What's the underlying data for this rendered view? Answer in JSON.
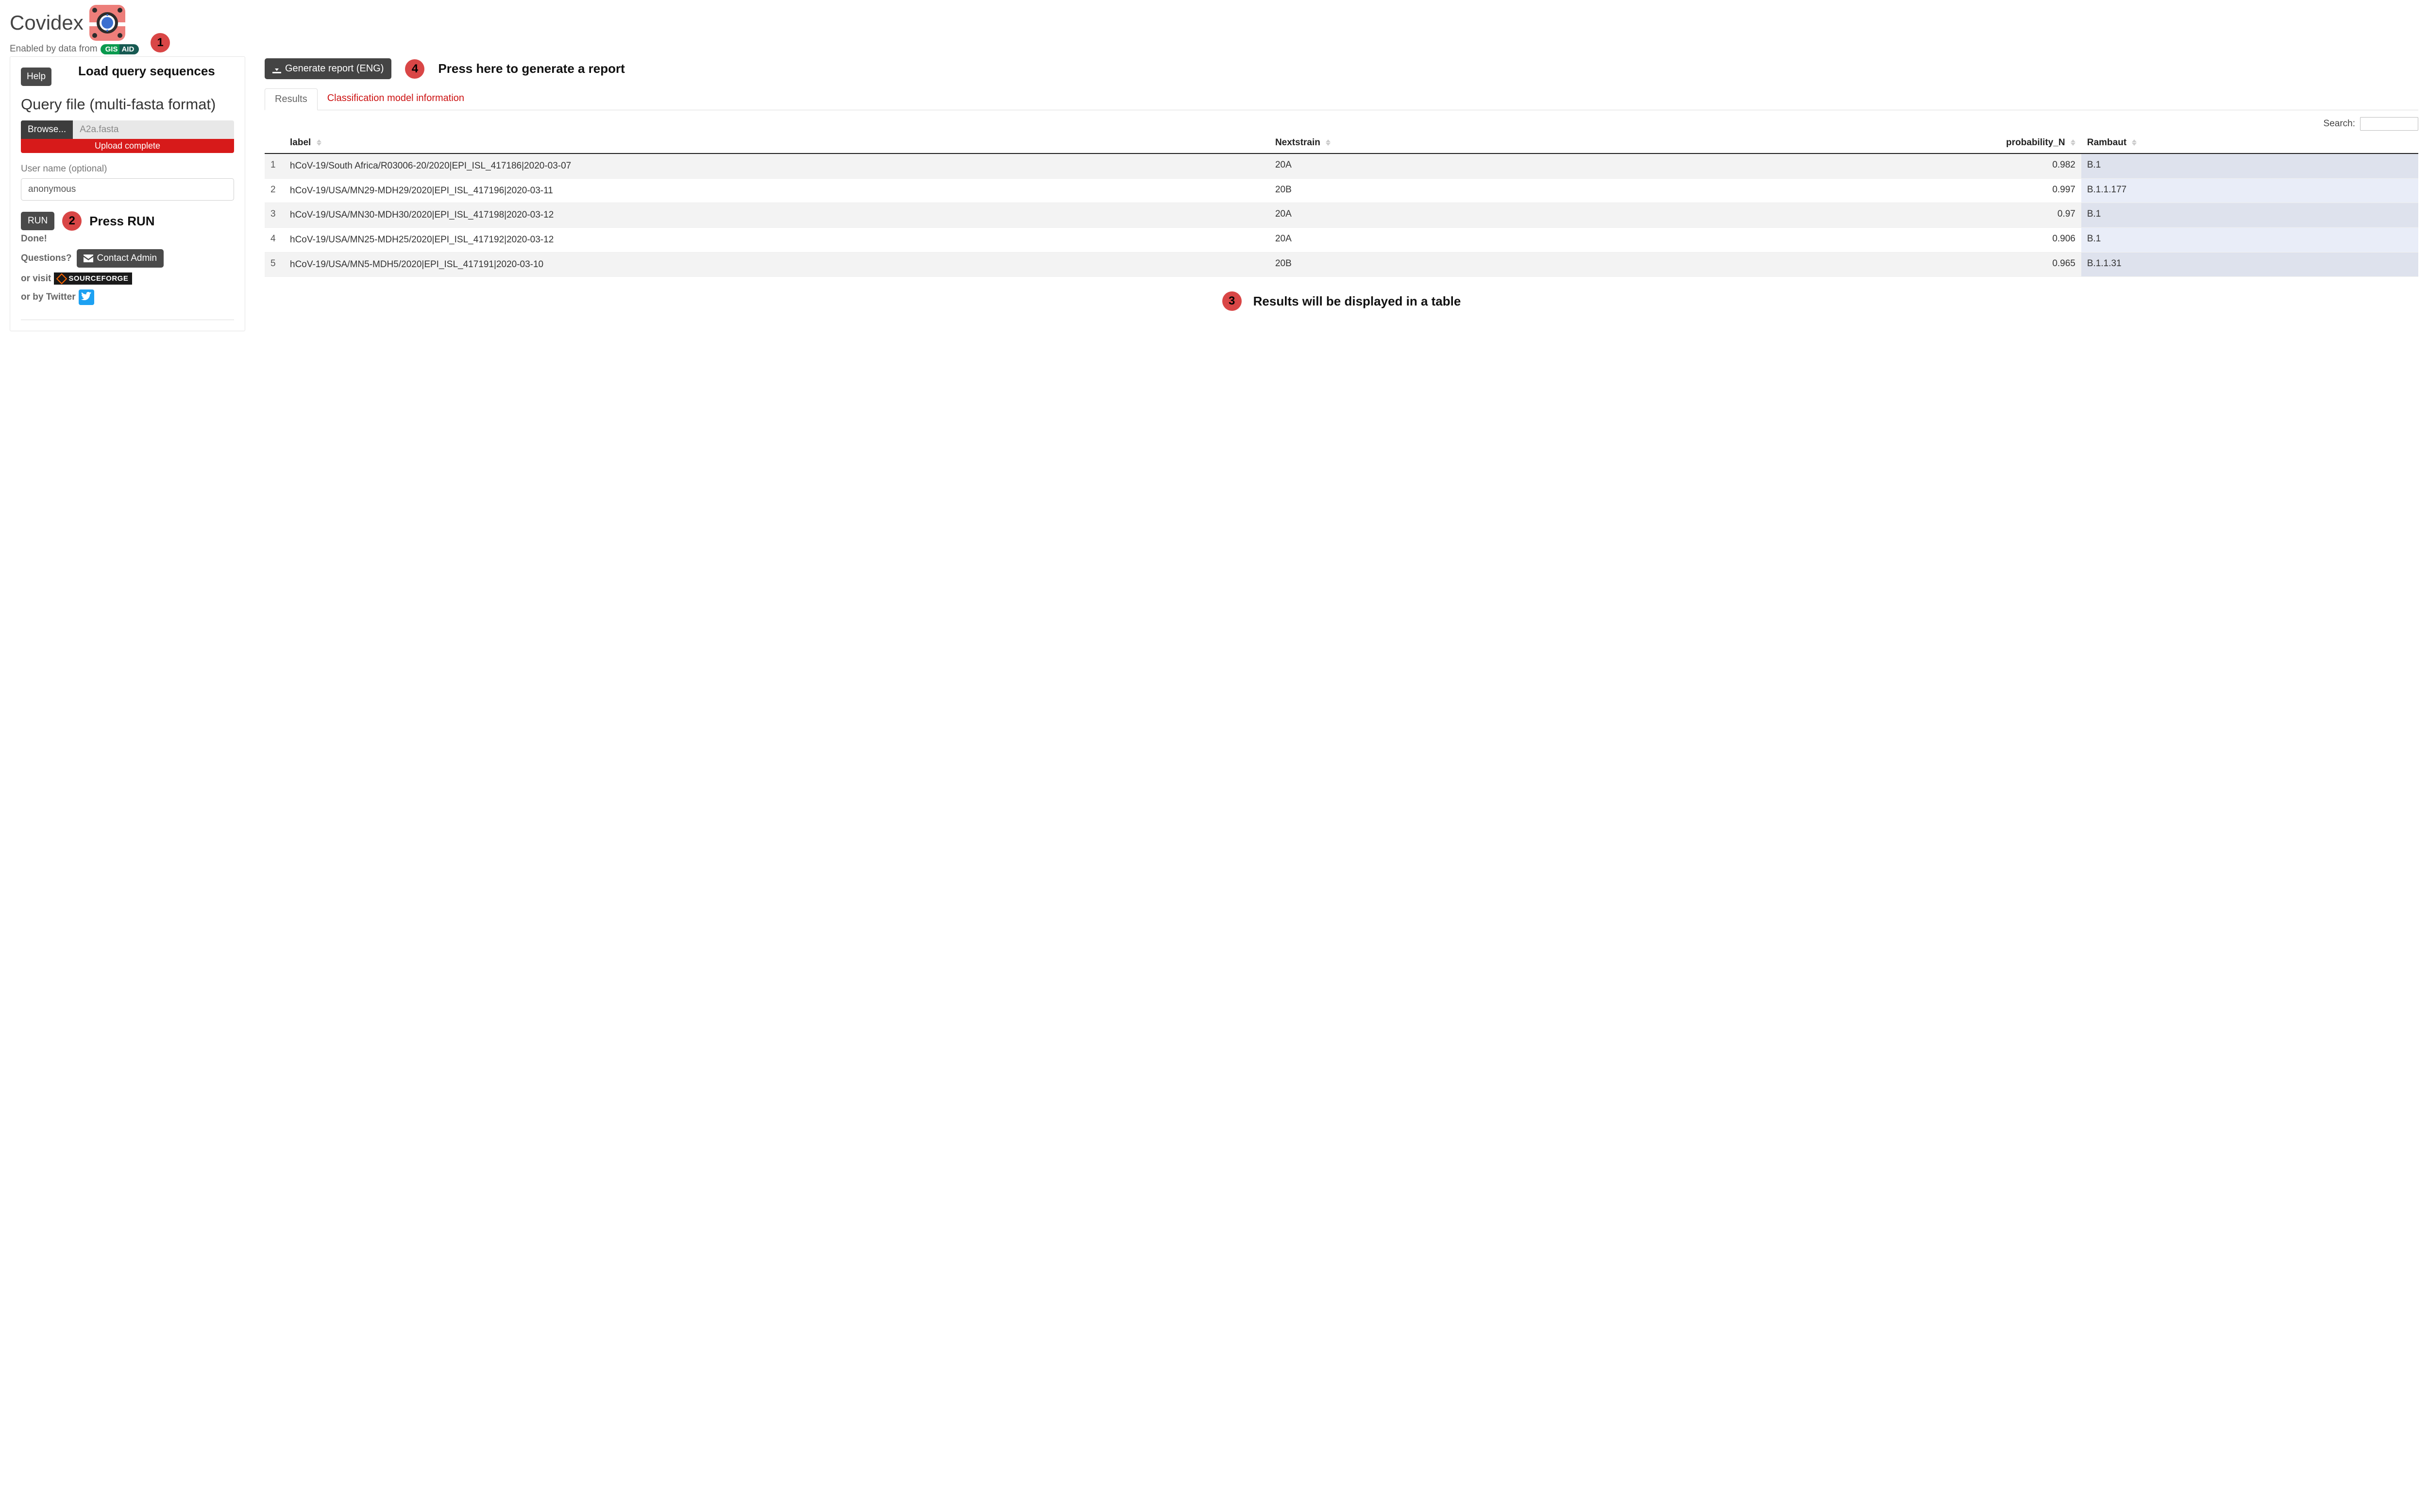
{
  "app": {
    "title": "Covidex"
  },
  "subhead": {
    "prefix": "Enabled by data from",
    "badge_left": "GIS",
    "badge_right": "AID"
  },
  "panel": {
    "help_btn": "Help",
    "section_title": "Query file (multi-fasta format)",
    "browse_btn": "Browse...",
    "file_name": "A2a.fasta",
    "upload_status": "Upload complete",
    "username_label": "User name (optional)",
    "username_value": "anonymous",
    "run_btn": "RUN",
    "done_text": "Done!",
    "questions_text": "Questions?",
    "contact_btn": "Contact Admin",
    "visit_text": "or visit",
    "sourceforge_text": "SOURCEFORGE",
    "twitter_text": "or by Twitter"
  },
  "right": {
    "generate_btn": "Generate report (ENG)",
    "tabs": {
      "results": "Results",
      "model": "Classification model information"
    },
    "search_label": "Search:",
    "columns": {
      "label": "label",
      "nextstrain": "Nextstrain",
      "prob": "probability_N",
      "rambaut": "Rambaut"
    },
    "rows": [
      {
        "idx": "1",
        "label": "hCoV-19/South Africa/R03006-20/2020|EPI_ISL_417186|2020-03-07",
        "nextstrain": "20A",
        "prob": "0.982",
        "rambaut": "B.1"
      },
      {
        "idx": "2",
        "label": "hCoV-19/USA/MN29-MDH29/2020|EPI_ISL_417196|2020-03-11",
        "nextstrain": "20B",
        "prob": "0.997",
        "rambaut": "B.1.1.177"
      },
      {
        "idx": "3",
        "label": "hCoV-19/USA/MN30-MDH30/2020|EPI_ISL_417198|2020-03-12",
        "nextstrain": "20A",
        "prob": "0.97",
        "rambaut": "B.1"
      },
      {
        "idx": "4",
        "label": "hCoV-19/USA/MN25-MDH25/2020|EPI_ISL_417192|2020-03-12",
        "nextstrain": "20A",
        "prob": "0.906",
        "rambaut": "B.1"
      },
      {
        "idx": "5",
        "label": "hCoV-19/USA/MN5-MDH5/2020|EPI_ISL_417191|2020-03-10",
        "nextstrain": "20B",
        "prob": "0.965",
        "rambaut": "B.1.1.31"
      }
    ]
  },
  "anno": {
    "n1": "1",
    "t1": "Load  query sequences",
    "n2": "2",
    "t2": "Press RUN",
    "n3": "3",
    "t3": "Results will be displayed in a table",
    "n4": "4",
    "t4": "Press here to generate a report"
  }
}
